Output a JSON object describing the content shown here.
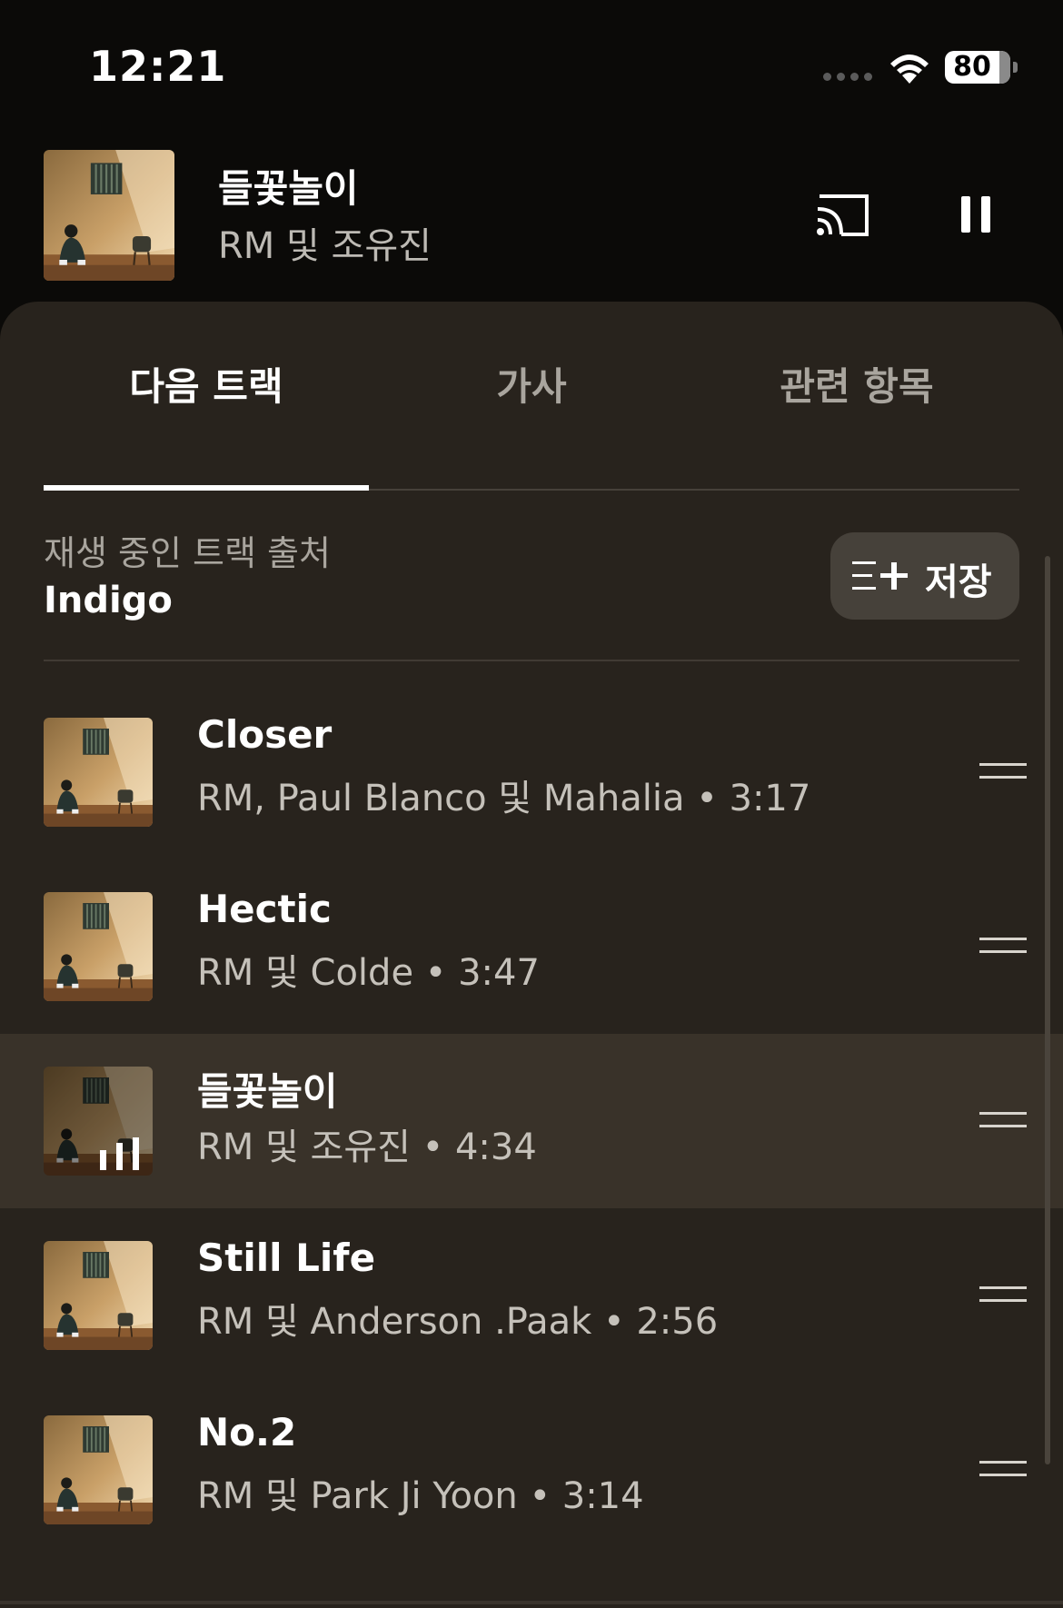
{
  "status_bar": {
    "time": "12:21",
    "battery": "80"
  },
  "mini_player": {
    "title": "들꽃놀이",
    "artist": "RM 및 조유진",
    "icons": [
      "cast-icon",
      "pause-icon"
    ]
  },
  "tabs": [
    {
      "label": "다음 트랙",
      "active": true
    },
    {
      "label": "가사",
      "active": false
    },
    {
      "label": "관련 항목",
      "active": false
    }
  ],
  "queue_header": {
    "label": "재생 중인 트랙 출처",
    "source": "Indigo",
    "save_label": "저장"
  },
  "tracks": [
    {
      "title": "Closer",
      "meta": "RM, Paul Blanco 및 Mahalia • 3:17",
      "playing": false
    },
    {
      "title": "Hectic",
      "meta": "RM 및 Colde • 3:47",
      "playing": false
    },
    {
      "title": "들꽃놀이",
      "meta": "RM 및 조유진 • 4:34",
      "playing": true
    },
    {
      "title": "Still Life",
      "meta": "RM 및 Anderson .Paak • 2:56",
      "playing": false
    },
    {
      "title": "No.2",
      "meta": "RM 및 Park Ji Yoon • 3:14",
      "playing": false
    }
  ],
  "colors": {
    "background": "#0b0a08",
    "sheet": "#28231d",
    "playing_row": "#393229",
    "save_button": "#46413a"
  }
}
